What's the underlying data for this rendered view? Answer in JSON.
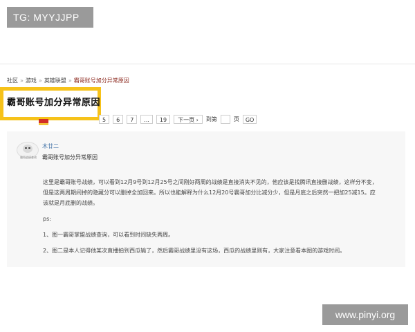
{
  "watermark_tag": "TG: MYYJJPP",
  "watermark_site": "www.pinyi.org",
  "breadcrumb": [
    {
      "label": "社区"
    },
    {
      "label": "游戏"
    },
    {
      "label": "英雄联盟"
    },
    {
      "label": "霸哥账号加分异常原因"
    }
  ],
  "breadcrumb_sep": "»",
  "title": "霸哥账号加分异常原因",
  "pager": {
    "pages": [
      "5",
      "6",
      "7",
      "...",
      "19"
    ],
    "next": "下一页 ›",
    "goto_label": "到第",
    "page_unit": "页",
    "go": "GO"
  },
  "post": {
    "author": "木廿二",
    "avatar_caption": "霸哥战绩查询",
    "subject": "霸哥账号加分异常原因",
    "paragraphs": [
      "这里是霸哥账号战绩，可以看到12月9号到12月25号之间刚好两周的战绩是直接消失不见的，他应该是找腾讯直接删战绩，这样分不变，但是这两周期间掉的隐藏分可以删掉全加回来。所以也能解释为什么12月20号霸哥加分比减分少，但是月底之后突然一把加25减15。应该就是月底删的战绩。",
      "ps:",
      "1、图一霸哥掌盟战绩查询，可以看到时间缺失两周。",
      "2、图二是本人记得他某次直播拍到西瓜输了，然后霸哥战绩里没有这场，西瓜的战绩里则有，大家注意看本图的游戏时间。"
    ]
  },
  "colors": {
    "highlight_border": "#f6c21a",
    "breadcrumb_active": "#8c2a1f",
    "author_link": "#3b6ea5"
  }
}
